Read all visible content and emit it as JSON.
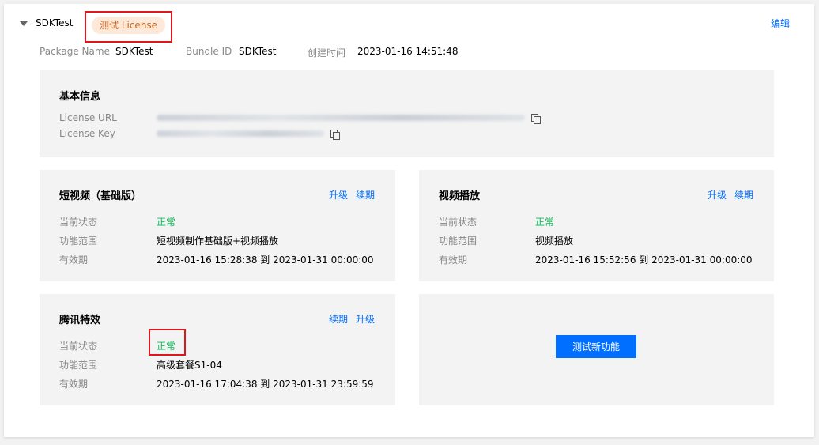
{
  "header": {
    "app_name": "SDKTest",
    "badge": "测试 License",
    "edit": "编辑"
  },
  "meta": {
    "package_label": "Package Name",
    "package_value": "SDKTest",
    "bundle_label": "Bundle ID",
    "bundle_value": "SDKTest",
    "created_label": "创建时间",
    "created_value": "2023-01-16 14:51:48"
  },
  "basic": {
    "title": "基本信息",
    "url_label": "License URL",
    "key_label": "License Key"
  },
  "modules": [
    {
      "title": "短视频（基础版）",
      "links": [
        "升级",
        "续期"
      ],
      "status_label": "当前状态",
      "status": "正常",
      "scope_label": "功能范围",
      "scope": "短视频制作基础版+视频播放",
      "validity_label": "有效期",
      "validity": "2023-01-16 15:28:38 到 2023-01-31 00:00:00"
    },
    {
      "title": "视频播放",
      "links": [
        "升级",
        "续期"
      ],
      "status_label": "当前状态",
      "status": "正常",
      "scope_label": "功能范围",
      "scope": "视频播放",
      "validity_label": "有效期",
      "validity": "2023-01-16 15:52:56 到 2023-01-31 00:00:00"
    },
    {
      "title": "腾讯特效",
      "links": [
        "续期",
        "升级"
      ],
      "status_label": "当前状态",
      "status": "正常",
      "scope_label": "功能范围",
      "scope": "高级套餐S1-04",
      "validity_label": "有效期",
      "validity": "2023-01-16 17:04:38 到 2023-01-31 23:59:59"
    }
  ],
  "test_button": "测试新功能",
  "colors": {
    "accent": "#006eff",
    "ok": "#0abf5b",
    "badge_bg": "#fde9d9",
    "badge_text": "#c8641e",
    "highlight": "#e0161d"
  }
}
